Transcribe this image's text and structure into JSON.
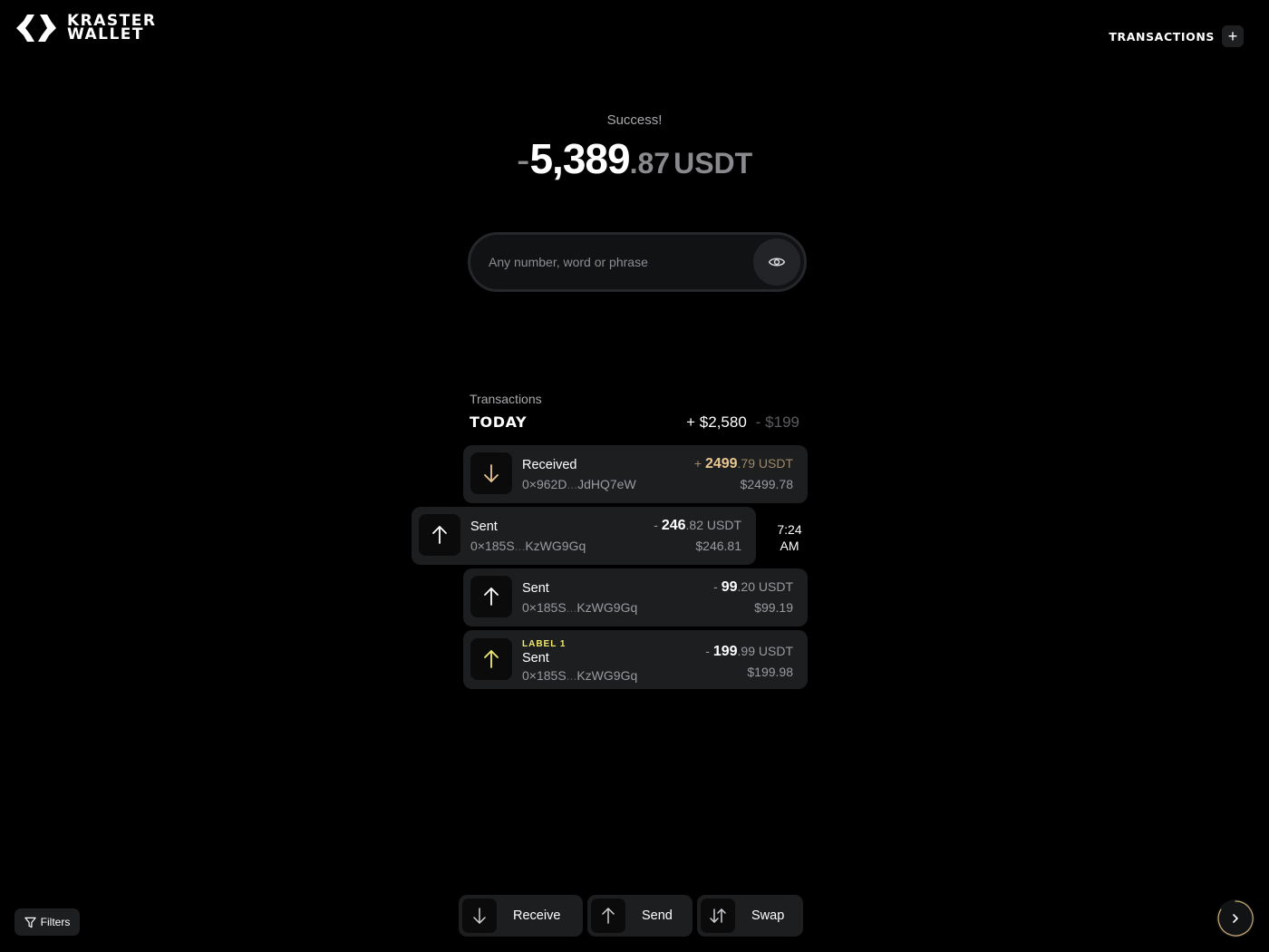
{
  "brand": {
    "line1": "KRASTER",
    "line2": "WALLET"
  },
  "header": {
    "transactions_label": "TRANSACTIONS",
    "add_symbol": "+"
  },
  "summary": {
    "status": "Success!",
    "sign": "-",
    "integer": "5,389",
    "decimal": ".87",
    "currency": "USDT"
  },
  "search": {
    "placeholder": "Any number, word or phrase",
    "value": ""
  },
  "transactions": {
    "heading": "Transactions",
    "group": "TODAY",
    "total_in": "+ $2,580",
    "total_out": "- $199",
    "items": [
      {
        "label": "Received",
        "addr_start": "0×962D",
        "addr_sep": "...",
        "addr_end": "JdHQ7eW",
        "amount_prefix": "+ ",
        "amount_int": "2499",
        "amount_dec": ".79",
        "amount_cur": " USDT",
        "usd": "$2499.78",
        "icon": "arrow-down-icon",
        "icon_color": "#e9c690"
      },
      {
        "label": "Sent",
        "addr_start": "0×185S",
        "addr_sep": "...",
        "addr_end": "KzWG9Gq",
        "amount_prefix": "- ",
        "amount_int": "246",
        "amount_dec": ".82",
        "amount_cur": " USDT",
        "usd": "$246.81",
        "icon": "arrow-up-icon",
        "icon_color": "#ffffff",
        "time_line1": "7:24",
        "time_line2": "AM"
      },
      {
        "label": "Sent",
        "addr_start": "0×185S",
        "addr_sep": "...",
        "addr_end": "KzWG9Gq",
        "amount_prefix": "- ",
        "amount_int": "99",
        "amount_dec": ".20",
        "amount_cur": " USDT",
        "usd": "$99.19",
        "icon": "arrow-up-icon",
        "icon_color": "#ffffff"
      },
      {
        "tag": "LABEL 1",
        "label": "Sent",
        "addr_start": "0×185S",
        "addr_sep": "...",
        "addr_end": "KzWG9Gq",
        "amount_prefix": "- ",
        "amount_int": "199",
        "amount_dec": ".99",
        "amount_cur": " USDT",
        "usd": "$199.98",
        "icon": "arrow-up-icon",
        "icon_color": "#f0ea6e"
      }
    ]
  },
  "footer": {
    "filters_label": "Filters",
    "actions": [
      {
        "label": "Receive",
        "icon": "arrow-down-icon"
      },
      {
        "label": "Send",
        "icon": "arrow-up-icon"
      },
      {
        "label": "Swap",
        "icon": "swap-icon"
      }
    ],
    "next_icon": "chevron-right-icon"
  },
  "colors": {
    "background": "#000000",
    "card": "#1d1e20",
    "gold": "#e9c690",
    "yellow": "#f0ea6e",
    "progress_ring": "#c9a977"
  }
}
